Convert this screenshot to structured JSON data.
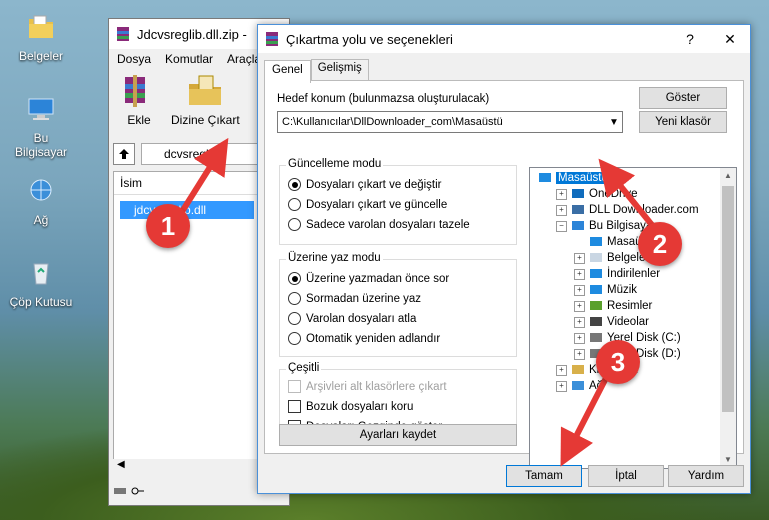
{
  "desktop": {
    "icons": [
      {
        "label": "Belgeler",
        "icon": "documents-folder-icon"
      },
      {
        "label": "Bu Bilgisayar",
        "icon": "computer-icon"
      },
      {
        "label": "Ağ",
        "icon": "network-icon"
      },
      {
        "label": "Çöp Kutusu",
        "icon": "recycle-bin-icon"
      }
    ]
  },
  "winrar": {
    "title": "Jdcvsreglib.dll.zip -",
    "menu": [
      "Dosya",
      "Komutlar",
      "Araçla"
    ],
    "toolbar": {
      "add": "Ekle",
      "extract_to": "Dizine Çıkart"
    },
    "path": "dcvsreglib",
    "column_name": "İsim",
    "file": "jdcvsreglib.dll",
    "scroll_left": "◀"
  },
  "dialog": {
    "title": "Çıkartma yolu ve seçenekleri",
    "help": "?",
    "close": "✕",
    "tabs": [
      "Genel",
      "Gelişmiş"
    ],
    "dest_label": "Hedef konum (bulunmazsa oluşturulacak)",
    "dest_value": "C:\\Kullanıcılar\\DllDownloader_com\\Masaüstü",
    "show_button": "Göster",
    "new_folder_button": "Yeni klasör",
    "update_group": {
      "title": "Güncelleme modu",
      "options": [
        "Dosyaları çıkart ve değiştir",
        "Dosyaları çıkart ve güncelle",
        "Sadece varolan dosyaları tazele"
      ],
      "selected": 0
    },
    "overwrite_group": {
      "title": "Üzerine yaz modu",
      "options": [
        "Üzerine yazmadan önce sor",
        "Sormadan üzerine yaz",
        "Varolan dosyaları atla",
        "Otomatik yeniden adlandır"
      ],
      "selected": 0
    },
    "misc_group": {
      "title": "Çeşitli",
      "options": [
        "Arşivleri alt klasörlere çıkart",
        "Bozuk dosyaları koru",
        "Dosyaları Gezginde göster"
      ]
    },
    "save_settings_button": "Ayarları kaydet",
    "tree": [
      {
        "label": "Masaüstü",
        "depth": 0,
        "expander": "",
        "icon": "desktop-icon",
        "selected": true
      },
      {
        "label": "OneDrive",
        "depth": 1,
        "expander": "+",
        "icon": "onedrive-icon"
      },
      {
        "label": "DLL Downloader.com",
        "depth": 1,
        "expander": "+",
        "icon": "user-icon"
      },
      {
        "label": "Bu Bilgisayar",
        "depth": 1,
        "expander": "−",
        "icon": "computer-icon"
      },
      {
        "label": "Masaüstü",
        "depth": 2,
        "expander": "",
        "icon": "desktop-icon"
      },
      {
        "label": "Belgeler",
        "depth": 2,
        "expander": "+",
        "icon": "documents-icon"
      },
      {
        "label": "İndirilenler",
        "depth": 2,
        "expander": "+",
        "icon": "downloads-icon"
      },
      {
        "label": "Müzik",
        "depth": 2,
        "expander": "+",
        "icon": "music-icon"
      },
      {
        "label": "Resimler",
        "depth": 2,
        "expander": "+",
        "icon": "pictures-icon"
      },
      {
        "label": "Videolar",
        "depth": 2,
        "expander": "+",
        "icon": "videos-icon"
      },
      {
        "label": "Yerel Disk (C:)",
        "depth": 2,
        "expander": "+",
        "icon": "drive-icon"
      },
      {
        "label": "Yerel Disk (D:)",
        "depth": 2,
        "expander": "+",
        "icon": "drive-icon"
      },
      {
        "label": "Kitaplıklar",
        "depth": 1,
        "expander": "+",
        "icon": "libraries-icon"
      },
      {
        "label": "Ağ",
        "depth": 1,
        "expander": "+",
        "icon": "network-icon"
      }
    ],
    "ok_button": "Tamam",
    "cancel_button": "İptal",
    "help_button": "Yardım"
  },
  "annotations": {
    "step1": "1",
    "step2": "2",
    "step3": "3",
    "color": "#e53935"
  }
}
